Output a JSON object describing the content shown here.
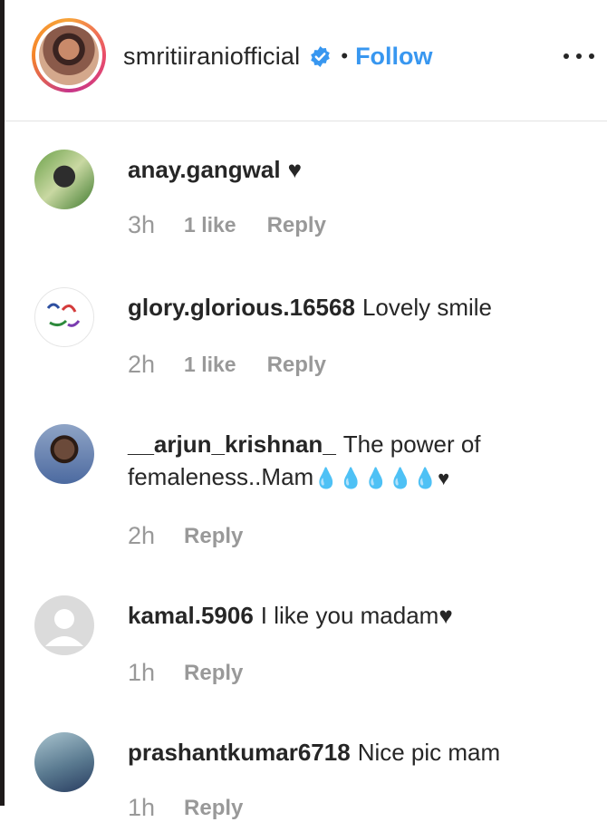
{
  "post_header": {
    "username": "smritiiraniofficial",
    "separator": "•",
    "follow_label": "Follow"
  },
  "comments": [
    {
      "user": "anay.gangwal",
      "text": "",
      "emoji": "♥",
      "time": "3h",
      "likes": "1 like",
      "reply": "Reply"
    },
    {
      "user": "glory.glorious.16568",
      "text": "Lovely smile",
      "emoji": "",
      "time": "2h",
      "likes": "1 like",
      "reply": "Reply"
    },
    {
      "user": "__arjun_krishnan_",
      "text": "The power of femaleness..Mam",
      "emoji": "💧💧💧💧💧♥",
      "time": "2h",
      "likes": "",
      "reply": "Reply"
    },
    {
      "user": "kamal.5906",
      "text": "I like you madam",
      "emoji": "♥",
      "time": "1h",
      "likes": "",
      "reply": "Reply"
    },
    {
      "user": "prashantkumar6718",
      "text": "Nice pic mam",
      "emoji": "",
      "time": "1h",
      "likes": "",
      "reply": "Reply"
    }
  ],
  "colors": {
    "link": "#3897f0",
    "meta": "#999999",
    "text": "#262626"
  }
}
